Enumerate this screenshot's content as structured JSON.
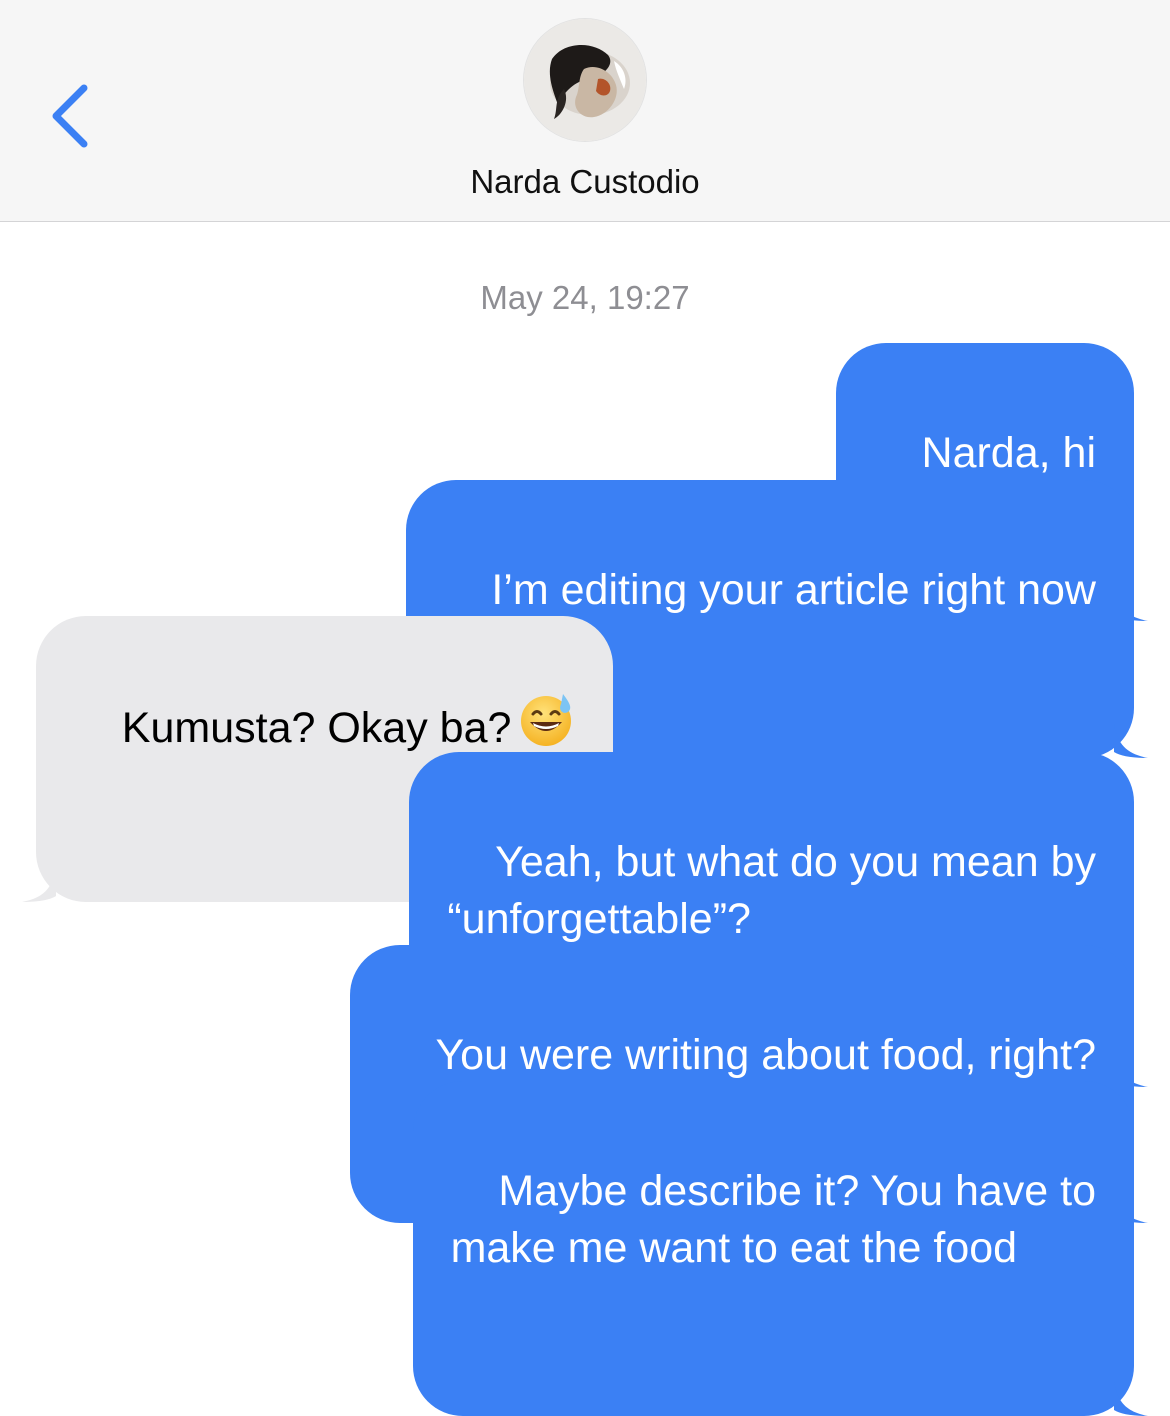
{
  "header": {
    "contact_name": "Narda Custodio",
    "back_icon": "chevron-left-icon",
    "accent_color": "#3b80f4"
  },
  "thread": {
    "timestamp": "May 24, 19:27",
    "messages": [
      {
        "direction": "outgoing",
        "text": "Narda, hi"
      },
      {
        "direction": "outgoing",
        "text": "I’m editing your article right now"
      },
      {
        "direction": "incoming",
        "text": "Kumusta? Okay ba?",
        "emoji": "grinning-face-with-sweat-emoji"
      },
      {
        "direction": "outgoing",
        "text": "Yeah, but what do you mean by\n“unforgettable”?"
      },
      {
        "direction": "outgoing",
        "text": "You were writing about food, right?"
      },
      {
        "direction": "outgoing",
        "text": "Maybe describe it? You have to\nmake me want to eat the food"
      }
    ]
  },
  "colors": {
    "outgoing_bubble": "#3b80f4",
    "incoming_bubble": "#e9e9eb",
    "header_bg": "#f6f6f6",
    "timestamp": "#8e8e93"
  }
}
